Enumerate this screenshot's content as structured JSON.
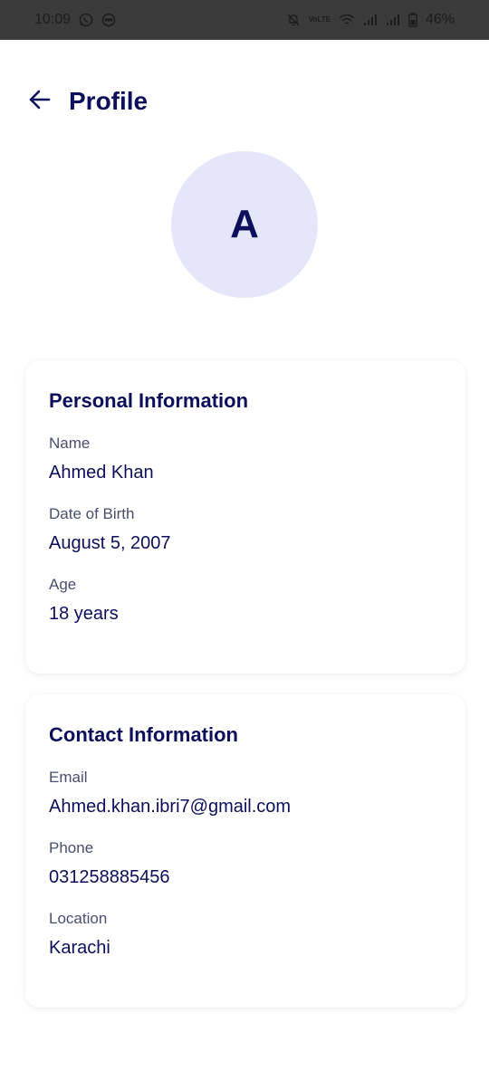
{
  "status_bar": {
    "time": "10:09",
    "left_icons": [
      "whatsapp-icon",
      "vpn-icon"
    ],
    "right_icons": [
      "mute-icon",
      "volte-icon",
      "wifi-icon",
      "signal-icon",
      "signal-icon",
      "battery-icon"
    ],
    "volte_text": "VoLTE",
    "battery_percent": "46%"
  },
  "header": {
    "title": "Profile",
    "back_icon": "arrow-left-icon"
  },
  "avatar": {
    "initial": "A",
    "background": "#e6e6fb"
  },
  "personal": {
    "title": "Personal Information",
    "fields": [
      {
        "label": "Name",
        "value": "Ahmed Khan"
      },
      {
        "label": "Date of Birth",
        "value": "August 5, 2007"
      },
      {
        "label": "Age",
        "value": "18 years"
      }
    ]
  },
  "contact": {
    "title": "Contact Information",
    "fields": [
      {
        "label": "Email",
        "value": "Ahmed.khan.ibri7@gmail.com"
      },
      {
        "label": "Phone",
        "value": "031258885456"
      },
      {
        "label": "Location",
        "value": "Karachi"
      }
    ]
  },
  "colors": {
    "primary_text": "#0b0f5c",
    "label_text": "#4a4e6e",
    "status_bar": "#3b3b3b"
  }
}
